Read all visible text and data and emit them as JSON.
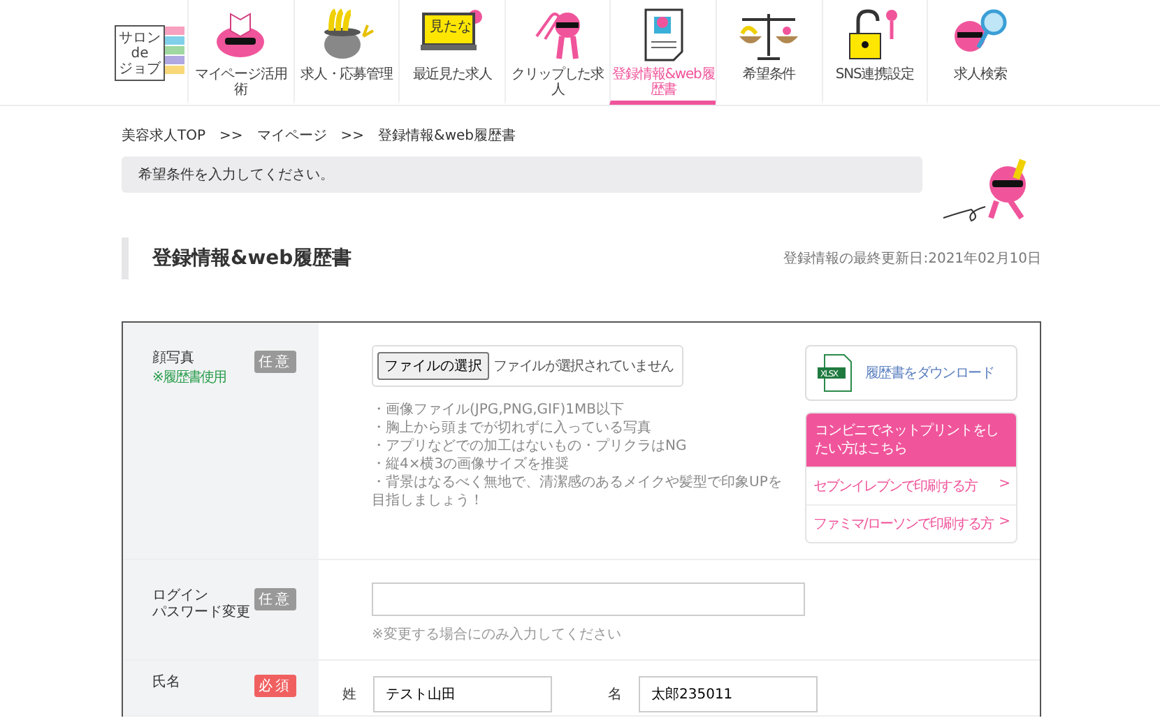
{
  "logo": {
    "lines": [
      "サロン",
      "de",
      "ジョブ"
    ]
  },
  "nav": [
    {
      "kind": "cap",
      "label": "マイページ活用術",
      "selected": false
    },
    {
      "kind": "pot",
      "label": "求人・応募管理",
      "selected": false
    },
    {
      "kind": "laptop",
      "label": "最近見た求人",
      "screen_text": "見たな",
      "selected": false
    },
    {
      "kind": "clip",
      "label": "クリップした求人",
      "selected": false
    },
    {
      "kind": "resume",
      "label": "登録情報&web履歴書",
      "selected": true
    },
    {
      "kind": "scale",
      "label": "希望条件",
      "selected": false
    },
    {
      "kind": "lock",
      "label": "SNS連携設定",
      "selected": false
    },
    {
      "kind": "search",
      "label": "求人検索",
      "selected": false
    }
  ],
  "breadcrumb": {
    "items": [
      "美容求人TOP",
      "マイページ",
      "登録情報&web履歴書"
    ],
    "separators": [
      ">>",
      ">>"
    ]
  },
  "notice": "希望条件を入力してください。",
  "page_title": "登録情報&web履歴書",
  "last_updated": "登録情報の最終更新日:2021年02月10日",
  "form": {
    "rows": [
      {
        "kind": "photo",
        "label": [
          "顔写真"
        ],
        "sublabel": "※履歴書使用",
        "badge": {
          "text": "任意",
          "required": false
        },
        "file_button": "ファイルの選択",
        "file_status": "ファイルが選択されていません",
        "hints": [
          "・画像ファイル(JPG,PNG,GIF)1MB以下",
          "・胸上から頭までが切れずに入っている写真",
          "・アプリなどでの加工はないもの・プリクラはNG",
          "・縦4×横3の画像サイズを推奨",
          "・背景はなるべく無地で、清潔感のあるメイクや髪型で印象UPを目指しましょう！"
        ],
        "download": {
          "icon_text": "XLSX",
          "label": "履歴書をダウンロード"
        },
        "print": {
          "header": "コンビニでネットプリントをしたい方はこちら",
          "links": [
            {
              "label": "セブンイレブンで印刷する方",
              "arrow": ">"
            },
            {
              "label": "ファミマ/ローソンで印刷する方",
              "arrow": ">"
            }
          ]
        }
      },
      {
        "kind": "password",
        "label": [
          "ログイン",
          "パスワード変更"
        ],
        "badge": {
          "text": "任意",
          "required": false
        },
        "hint": "※変更する場合にのみ入力してください"
      },
      {
        "kind": "name",
        "label": [
          "氏名"
        ],
        "badge": {
          "text": "必須",
          "required": true
        },
        "fields": [
          {
            "label": "姓",
            "value": "テスト山田"
          },
          {
            "label": "名",
            "value": "太郎235011"
          }
        ]
      }
    ]
  }
}
